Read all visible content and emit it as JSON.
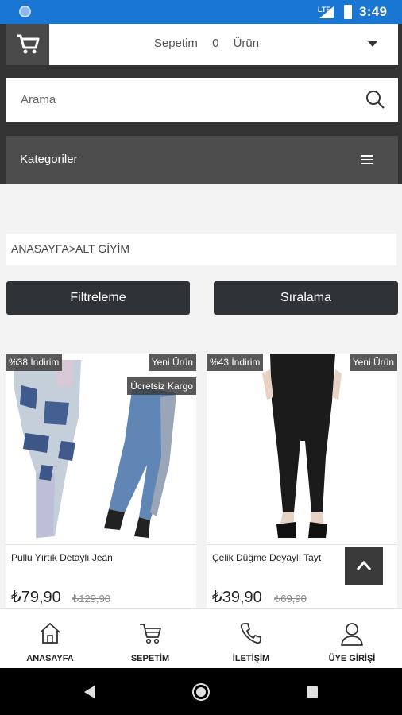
{
  "status_bar": {
    "network": "LTE",
    "time": "3:49"
  },
  "cart": {
    "label": "Sepetim",
    "count": "0",
    "unit": "Ürün"
  },
  "search": {
    "placeholder": "Arama"
  },
  "categories": {
    "label": "Kategoriler"
  },
  "breadcrumb": {
    "text": "ANASAYFA>ALT GİYİM"
  },
  "actions": {
    "filter_label": "Filtreleme",
    "sort_label": "Sıralama"
  },
  "products": [
    {
      "name": "Pullu Yırtık Detaylı Jean",
      "price": "₺79,90",
      "old_price": "₺129,90",
      "badges": {
        "discount": "%38 İndirim",
        "new": "Yeni Ürün",
        "shipping": "Ücretsiz Kargo"
      }
    },
    {
      "name": "Çelik Düğme Deyaylı Tayt",
      "price": "₺39,90",
      "old_price": "₺69,90",
      "badges": {
        "discount": "%43 İndirim",
        "new": "Yeni Ürün"
      }
    }
  ],
  "bottom_nav": [
    {
      "label": "ANASAYFA",
      "icon": "home-icon"
    },
    {
      "label": "SEPETİM",
      "icon": "cart-icon"
    },
    {
      "label": "İLETİŞİM",
      "icon": "phone-icon"
    },
    {
      "label": "ÜYE GİRİŞİ",
      "icon": "user-icon"
    }
  ],
  "colors": {
    "status_bar": "#1976d2",
    "header": "#333333",
    "button": "#2f3338"
  }
}
